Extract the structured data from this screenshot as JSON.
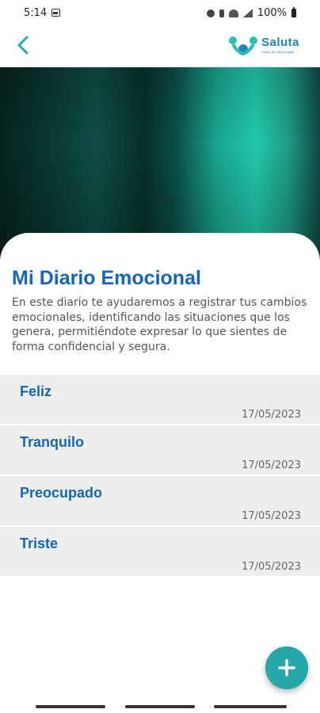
{
  "status_bar": {
    "time": "5:14",
    "battery": "100%",
    "icons": [
      "image-icon",
      "alarm-icon",
      "bluetooth-icon",
      "wifi-icon",
      "signal-icon",
      "battery-icon"
    ]
  },
  "header": {
    "back_icon": "chevron-left-icon",
    "logo_name": "Saluta",
    "logo_tagline": "Centro de Salud Digital",
    "colors": {
      "accent": "#26a7a8",
      "brand": "#1a84c4",
      "logo_mark": "#2bbfb0"
    }
  },
  "hero": {
    "image": "teal abstract blurred background"
  },
  "page": {
    "title": "Mi Diario Emocional",
    "description": "En este diario te ayudaremos a registrar tus cambios emocionales, identificando las situaciones que los genera, permitiéndote expresar lo que sientes de forma confidencial y segura.",
    "title_color": "#1466b8"
  },
  "entries": [
    {
      "mood": "Feliz",
      "date": "17/05/2023"
    },
    {
      "mood": "Tranquilo",
      "date": "17/05/2023"
    },
    {
      "mood": "Preocupado",
      "date": "17/05/2023"
    },
    {
      "mood": "Triste",
      "date": "17/05/2023"
    }
  ],
  "fab": {
    "icon": "plus-icon",
    "color": "#26a7a8"
  }
}
